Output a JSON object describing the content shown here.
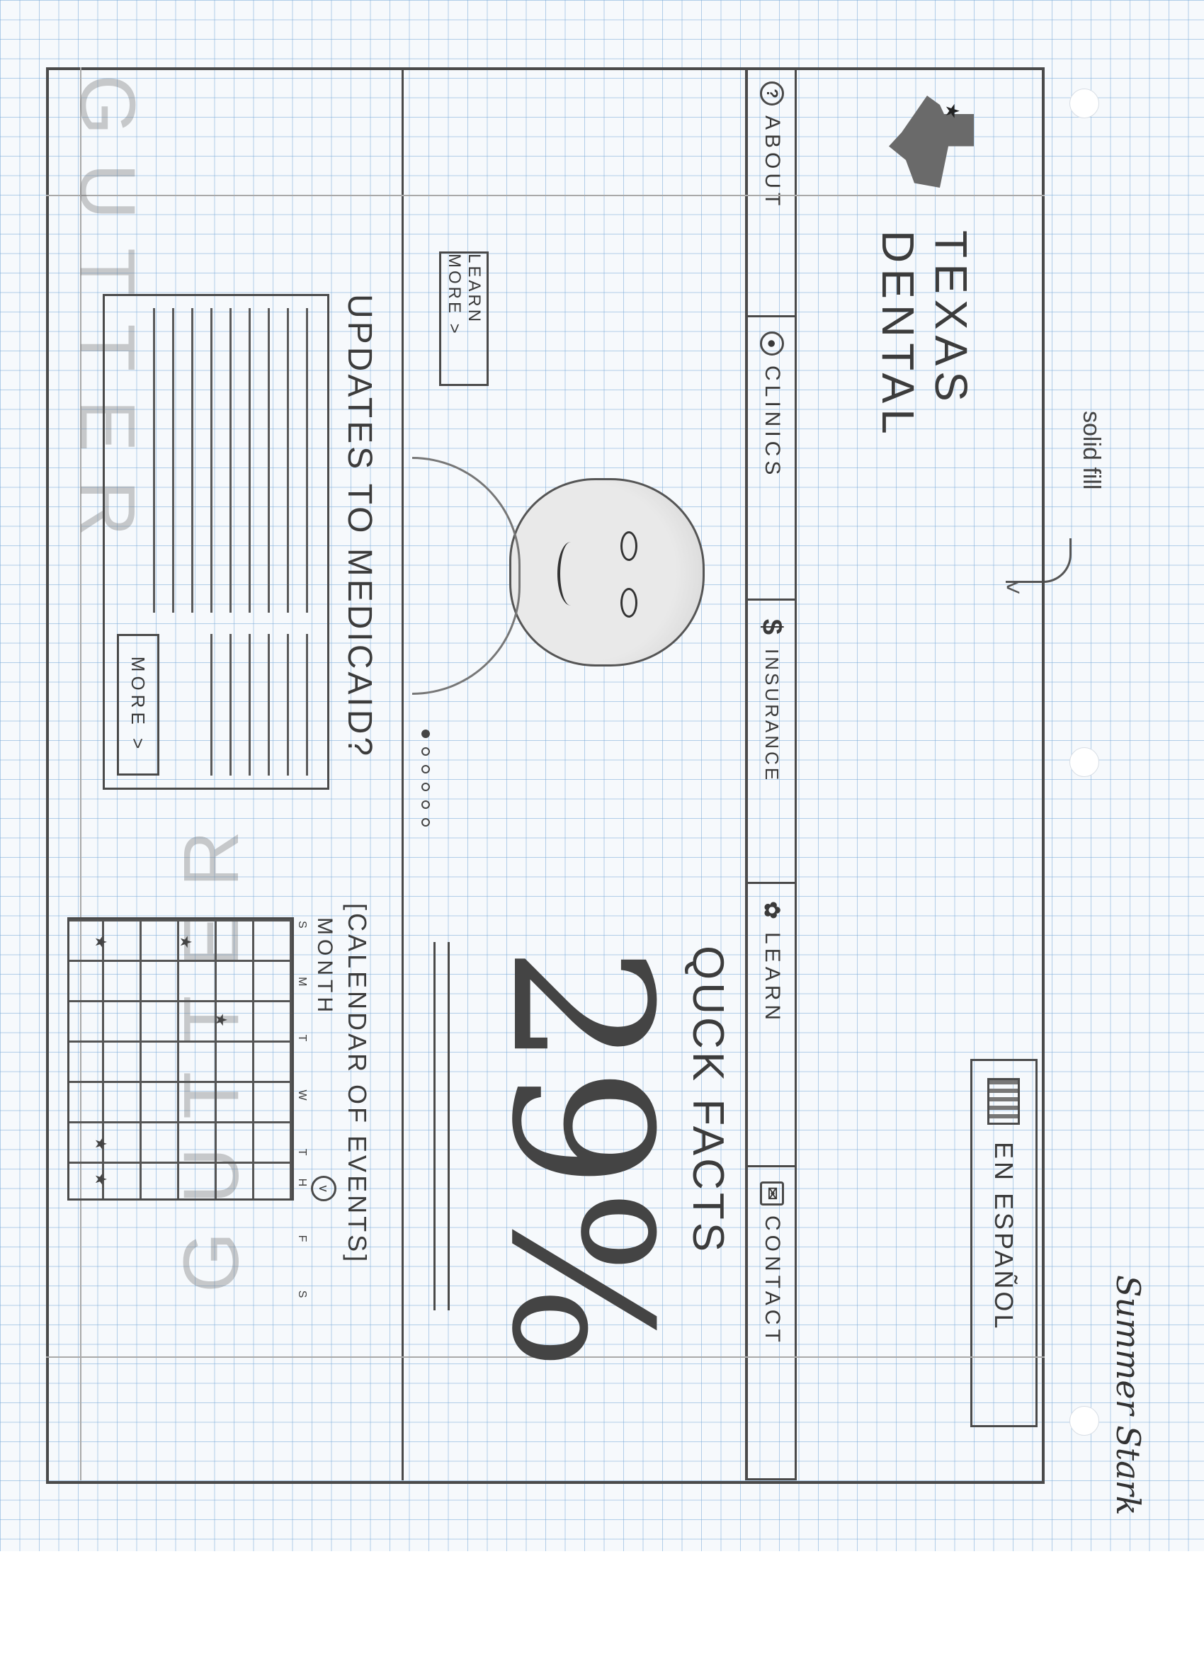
{
  "logo": {
    "line1": "TEXAS",
    "line2": "DENTAL",
    "image": "texas-state-flag-map"
  },
  "language_button": {
    "label": "EN ESPAÑOL",
    "icon": "book-icon"
  },
  "annotation_fill": {
    "label": "solid fill"
  },
  "nav": {
    "items": [
      {
        "label": "ABOUT",
        "icon": "question-icon",
        "glyph": "?"
      },
      {
        "label": "CLINICS",
        "icon": "location-pin-icon",
        "glyph": "●"
      },
      {
        "label": "INSURANCE",
        "icon": "dollar-icon",
        "glyph": "$"
      },
      {
        "label": "LEARN",
        "icon": "tooth-icon",
        "glyph": "✿"
      },
      {
        "label": "CONTACT",
        "icon": "mail-icon",
        "glyph": "✉"
      }
    ]
  },
  "gutter": {
    "label": "GUTTER"
  },
  "hero": {
    "learn_more_label": "LEARN MORE >",
    "active_slide": 1,
    "slide_count": 6
  },
  "quick_facts": {
    "title": "QUCK FACTS",
    "value": "29%"
  },
  "medicaid": {
    "title": "UPDATES TO MEDICAID?",
    "more_label": "MORE >"
  },
  "calendar": {
    "title": "[CALENDAR OF EVENTS]",
    "month_label": "MONTH",
    "weekdays": "S M T W TH F S"
  },
  "signature": {
    "text": "Summer Stark"
  }
}
